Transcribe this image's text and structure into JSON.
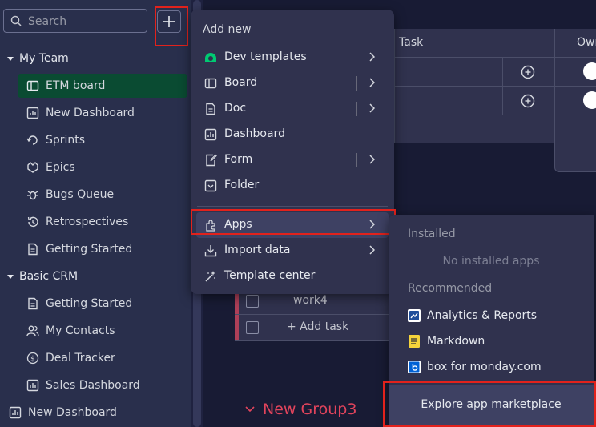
{
  "sidebar": {
    "search_placeholder": "Search",
    "add_label": "+",
    "sections": [
      {
        "label": "My Team",
        "items": [
          {
            "label": "ETM board",
            "icon": "board-icon",
            "active": true
          },
          {
            "label": "New Dashboard",
            "icon": "dashboard-icon"
          },
          {
            "label": "Sprints",
            "icon": "sprints-icon"
          },
          {
            "label": "Epics",
            "icon": "epics-icon"
          },
          {
            "label": "Bugs Queue",
            "icon": "bug-icon"
          },
          {
            "label": "Retrospectives",
            "icon": "history-icon"
          },
          {
            "label": "Getting Started",
            "icon": "doc-icon"
          }
        ]
      },
      {
        "label": "Basic CRM",
        "items": [
          {
            "label": "Getting Started",
            "icon": "doc-icon"
          },
          {
            "label": "My Contacts",
            "icon": "contacts-icon"
          },
          {
            "label": "Deal Tracker",
            "icon": "dollar-icon"
          },
          {
            "label": "Sales Dashboard",
            "icon": "dashboard-icon"
          }
        ]
      }
    ],
    "bottom_item": {
      "label": "New Dashboard",
      "icon": "dashboard-icon"
    }
  },
  "board": {
    "task_header": "Task",
    "owner_header": "Own",
    "rows": [
      "work4",
      "+ Add task"
    ],
    "group_label": "New Group3"
  },
  "add_menu": {
    "title": "Add new",
    "items": [
      {
        "label": "Dev templates",
        "icon": "dev-templates-icon"
      },
      {
        "label": "Board",
        "icon": "board-icon"
      },
      {
        "label": "Doc",
        "icon": "doc-icon"
      },
      {
        "label": "Dashboard",
        "icon": "dashboard-icon"
      },
      {
        "label": "Form",
        "icon": "form-icon"
      },
      {
        "label": "Folder",
        "icon": "folder-icon"
      },
      {
        "label": "Apps",
        "icon": "apps-icon"
      },
      {
        "label": "Import data",
        "icon": "import-icon"
      },
      {
        "label": "Template center",
        "icon": "template-icon"
      }
    ]
  },
  "apps_submenu": {
    "installed_header": "Installed",
    "installed_empty": "No installed apps",
    "recommended_header": "Recommended",
    "recommended": [
      {
        "label": "Analytics & Reports",
        "icon": "analytics-app-icon"
      },
      {
        "label": "Markdown",
        "icon": "markdown-app-icon"
      },
      {
        "label": "box for monday.com",
        "icon": "box-app-icon"
      }
    ],
    "explore_label": "Explore app marketplace"
  },
  "colors": {
    "accent_red": "#e2221c",
    "active_green": "#0a4b32",
    "group_red": "#e2445c"
  }
}
